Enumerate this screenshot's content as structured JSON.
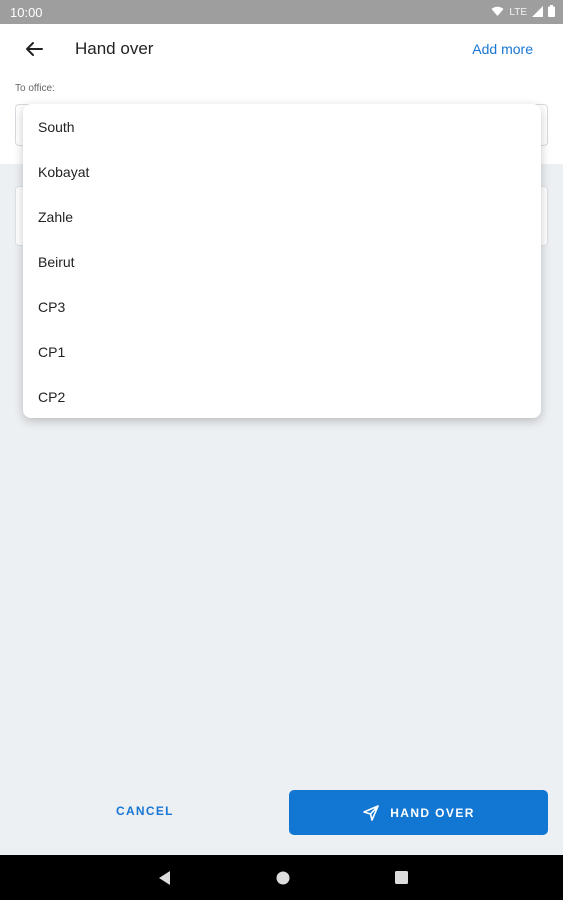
{
  "status_bar": {
    "time": "10:00",
    "network": "LTE",
    "icons": [
      "wifi-icon",
      "signal-icon",
      "battery-icon"
    ]
  },
  "header": {
    "title": "Hand over",
    "action": "Add more",
    "office_label": "To office:"
  },
  "dropdown": {
    "items": [
      {
        "label": "South"
      },
      {
        "label": "Kobayat"
      },
      {
        "label": "Zahle"
      },
      {
        "label": "Beirut"
      },
      {
        "label": "CP3"
      },
      {
        "label": "CP1"
      },
      {
        "label": "CP2"
      }
    ]
  },
  "actions": {
    "cancel": "CANCEL",
    "hand_over": "HAND OVER"
  },
  "colors": {
    "accent": "#1976d2",
    "button": "#1276d3",
    "background": "#edf0f3"
  }
}
